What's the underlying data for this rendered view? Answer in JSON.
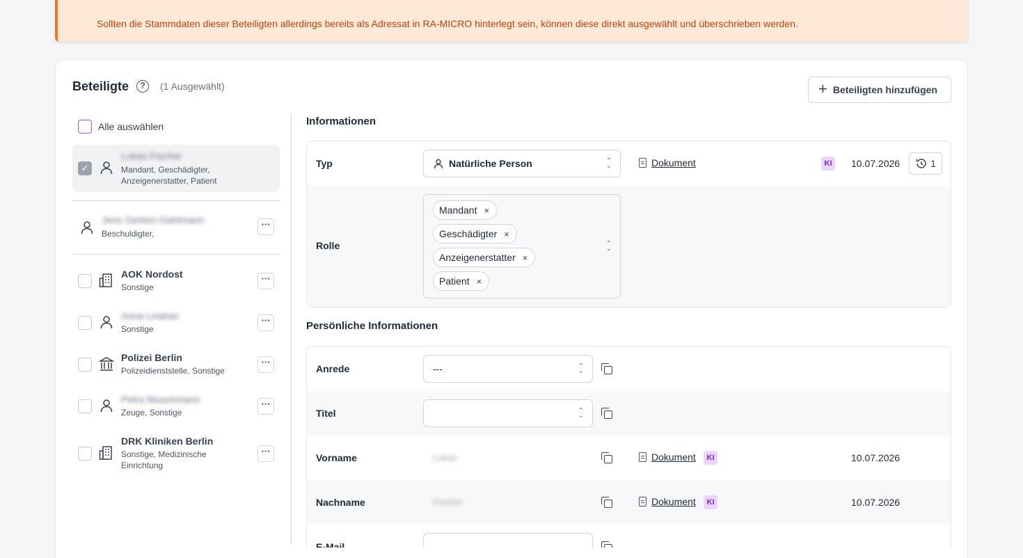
{
  "banner": {
    "text": "Sollten die Stammdaten dieser Beteiligten allerdings bereits als Adressat in RA-MICRO hinterlegt sein, können diese direkt ausgewählt und überschrieben werden."
  },
  "header": {
    "title": "Beteiligte",
    "help_icon": "?",
    "selected_count": "(1 Ausgewählt)",
    "add_button": "Beteiligten hinzufügen",
    "add_icon": "+"
  },
  "list": {
    "select_all": "Alle auswählen",
    "items": [
      {
        "name": "Lukas Fischer",
        "roles": "Mandant, Geschädigter, Anzeigenerstatter, Patient",
        "icon": "person-icon",
        "blurred": true,
        "selected": true
      },
      {
        "name": "Jens Gerken-Dahlmann",
        "roles": "Beschuldigter,",
        "icon": "person-icon",
        "blurred": true
      },
      {
        "name": "AOK Nordost",
        "roles": "Sonstige",
        "icon": "building-icon",
        "blurred": false
      },
      {
        "name": "Anna Lindner",
        "roles": "Sonstige",
        "icon": "person-icon",
        "blurred": true
      },
      {
        "name": "Polizei Berlin",
        "roles": "Polizeidienststelle, Sonstige",
        "icon": "institution-icon",
        "blurred": false
      },
      {
        "name": "Petra Muschmann",
        "roles": "Zeuge, Sonstige",
        "icon": "person-icon",
        "blurred": true
      },
      {
        "name": "DRK Kliniken Berlin",
        "roles": "Sonstige, Medizinische Einrichtung",
        "icon": "building-icon",
        "blurred": false
      }
    ]
  },
  "info": {
    "section_title": "Informationen",
    "typ_label": "Typ",
    "typ_value": "Natürliche Person",
    "doc_link": "Dokument",
    "ki_badge": "KI",
    "typ_date": "10.07.2026",
    "history_count": "1",
    "rolle_label": "Rolle",
    "roles": [
      "Mandant",
      "Geschädigter",
      "Anzeigenerstatter",
      "Patient"
    ],
    "tag_remove": "×"
  },
  "personal": {
    "section_title": "Persönliche Informationen",
    "anrede_label": "Anrede",
    "anrede_value": "---",
    "titel_label": "Titel",
    "titel_value": "",
    "vorname_label": "Vorname",
    "vorname_value": "Lukas",
    "vorname_doc": "Dokument",
    "vorname_ki": "KI",
    "vorname_date": "10.07.2026",
    "nachname_label": "Nachname",
    "nachname_value": "Fischer",
    "nachname_doc": "Dokument",
    "nachname_ki": "KI",
    "nachname_date": "10.07.2026",
    "email_label": "E-Mail"
  },
  "colors": {
    "accent_purple": "#a855f7",
    "banner_bg": "#fde9d6",
    "banner_text": "#c2410c",
    "ki_badge_bg": "#e9d5ff"
  }
}
